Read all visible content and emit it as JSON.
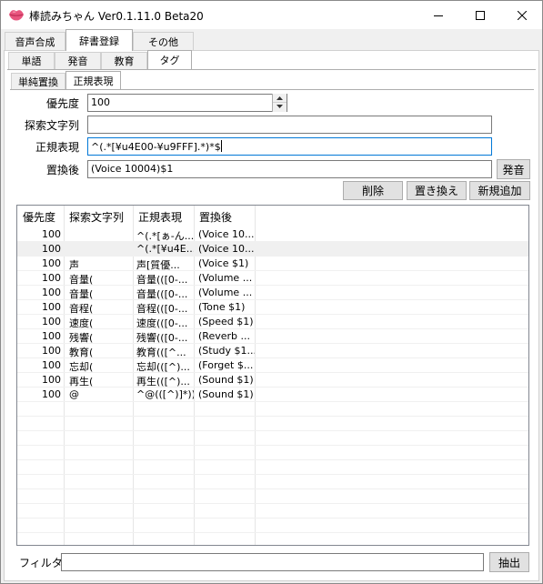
{
  "app": {
    "title": "棒読みちゃん Ver0.1.11.0 Beta20",
    "icon": "lips-icon"
  },
  "window_controls": {
    "minimize": "minimize-icon",
    "maximize": "maximize-icon",
    "close": "close-icon"
  },
  "main_tabs": [
    {
      "label": "音声合成",
      "active": false
    },
    {
      "label": "辞書登録",
      "active": true
    },
    {
      "label": "その他",
      "active": false
    }
  ],
  "sub_tabs": [
    {
      "label": "単語",
      "active": false
    },
    {
      "label": "発音",
      "active": false
    },
    {
      "label": "教育",
      "active": false
    },
    {
      "label": "タグ",
      "active": true
    }
  ],
  "tag_tabs": [
    {
      "label": "単純置換",
      "active": false
    },
    {
      "label": "正規表現",
      "active": true
    }
  ],
  "form": {
    "priority_label": "優先度",
    "priority_value": "100",
    "search_label": "探索文字列",
    "search_value": "",
    "regex_label": "正規表現",
    "regex_value": "^(.*[¥u4E00-¥u9FFF].*)*$",
    "replace_label": "置換後",
    "replace_value": "(Voice 10004)$1",
    "speak_button": "発音"
  },
  "actions": {
    "delete": "削除",
    "replace": "置き換え",
    "add": "新規追加"
  },
  "table": {
    "columns": [
      "優先度",
      "探索文字列",
      "正規表現",
      "置換後"
    ],
    "rows": [
      [
        "100",
        "",
        "^(.*[ぁ-ん...",
        "(Voice 10..."
      ],
      [
        "100",
        "",
        "^(.*[¥u4E...",
        "(Voice 10..."
      ],
      [
        "100",
        "声",
        "声[質優...",
        "(Voice $1)"
      ],
      [
        "100",
        "音量(",
        "音量(([0-...",
        "(Volume ..."
      ],
      [
        "100",
        "音量(",
        "音量(([0-...",
        "(Volume ..."
      ],
      [
        "100",
        "音程(",
        "音程(([0-...",
        "(Tone $1)"
      ],
      [
        "100",
        "速度(",
        "速度(([0-...",
        "(Speed $1)"
      ],
      [
        "100",
        "残響(",
        "残響(([0-...",
        "(Reverb ..."
      ],
      [
        "100",
        "教育(",
        "教育(([^...",
        "(Study $1..."
      ],
      [
        "100",
        "忘却(",
        "忘却(([^)...",
        "(Forget $..."
      ],
      [
        "100",
        "再生(",
        "再生(([^)...",
        "(Sound $1)"
      ],
      [
        "100",
        "@",
        "^@(([^)]*))",
        "(Sound $1)"
      ]
    ],
    "selected_row": 1
  },
  "filter": {
    "label": "フィルタ",
    "value": "",
    "button": "抽出"
  }
}
